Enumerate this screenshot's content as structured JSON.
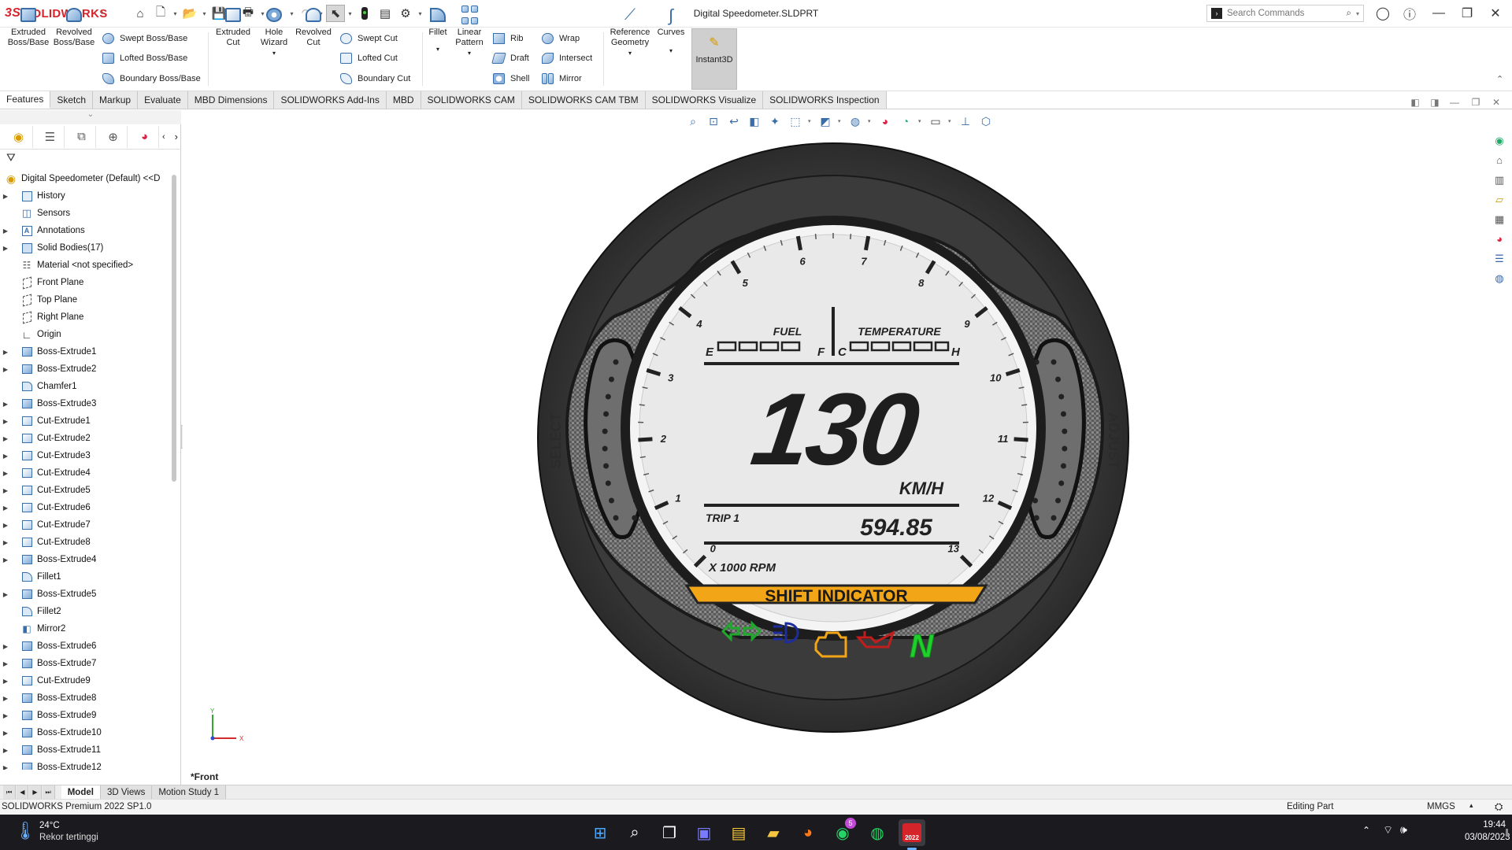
{
  "app": {
    "brand_ds": "3S",
    "brand_name": "SOLIDWORKS",
    "document_title": "Digital Speedometer.SLDPRT"
  },
  "search": {
    "placeholder": "Search Commands"
  },
  "ribbon": {
    "extruded_boss": "Extruded\nBoss/Base",
    "revolved_boss": "Revolved\nBoss/Base",
    "swept_boss": "Swept Boss/Base",
    "lofted_boss": "Lofted Boss/Base",
    "boundary_boss": "Boundary Boss/Base",
    "extruded_cut": "Extruded\nCut",
    "hole_wizard": "Hole\nWizard",
    "revolved_cut": "Revolved\nCut",
    "swept_cut": "Swept Cut",
    "lofted_cut": "Lofted Cut",
    "boundary_cut": "Boundary Cut",
    "fillet": "Fillet",
    "linear_pattern": "Linear\nPattern",
    "rib": "Rib",
    "draft": "Draft",
    "shell": "Shell",
    "wrap": "Wrap",
    "intersect": "Intersect",
    "mirror": "Mirror",
    "reference_geometry": "Reference\nGeometry",
    "curves": "Curves",
    "instant3d": "Instant3D"
  },
  "tabs": [
    "Features",
    "Sketch",
    "Markup",
    "Evaluate",
    "MBD Dimensions",
    "SOLIDWORKS Add-Ins",
    "MBD",
    "SOLIDWORKS CAM",
    "SOLIDWORKS CAM TBM",
    "SOLIDWORKS Visualize",
    "SOLIDWORKS Inspection"
  ],
  "tree": {
    "root": "Digital Speedometer (Default) <<D",
    "items": [
      {
        "label": "History",
        "icon": "history-icon",
        "exp": true
      },
      {
        "label": "Sensors",
        "icon": "sensors-icon",
        "exp": false
      },
      {
        "label": "Annotations",
        "icon": "annotations-icon",
        "exp": true
      },
      {
        "label": "Solid Bodies(17)",
        "icon": "solid-bodies-icon",
        "exp": true
      },
      {
        "label": "Material <not specified>",
        "icon": "material-icon",
        "exp": false
      },
      {
        "label": "Front Plane",
        "icon": "plane-icon",
        "exp": false
      },
      {
        "label": "Top Plane",
        "icon": "plane-icon",
        "exp": false
      },
      {
        "label": "Right Plane",
        "icon": "plane-icon",
        "exp": false
      },
      {
        "label": "Origin",
        "icon": "origin-icon",
        "exp": false
      },
      {
        "label": "Boss-Extrude1",
        "icon": "boss-extrude-icon",
        "exp": true
      },
      {
        "label": "Boss-Extrude2",
        "icon": "boss-extrude-icon",
        "exp": true
      },
      {
        "label": "Chamfer1",
        "icon": "chamfer-icon",
        "exp": false
      },
      {
        "label": "Boss-Extrude3",
        "icon": "boss-extrude-icon",
        "exp": true
      },
      {
        "label": "Cut-Extrude1",
        "icon": "cut-extrude-icon",
        "exp": true
      },
      {
        "label": "Cut-Extrude2",
        "icon": "cut-extrude-icon",
        "exp": true
      },
      {
        "label": "Cut-Extrude3",
        "icon": "cut-extrude-icon",
        "exp": true
      },
      {
        "label": "Cut-Extrude4",
        "icon": "cut-extrude-icon",
        "exp": true
      },
      {
        "label": "Cut-Extrude5",
        "icon": "cut-extrude-icon",
        "exp": true
      },
      {
        "label": "Cut-Extrude6",
        "icon": "cut-extrude-icon",
        "exp": true
      },
      {
        "label": "Cut-Extrude7",
        "icon": "cut-extrude-icon",
        "exp": true
      },
      {
        "label": "Cut-Extrude8",
        "icon": "cut-extrude-icon",
        "exp": true
      },
      {
        "label": "Boss-Extrude4",
        "icon": "boss-extrude-icon",
        "exp": true
      },
      {
        "label": "Fillet1",
        "icon": "fillet-icon",
        "exp": false
      },
      {
        "label": "Boss-Extrude5",
        "icon": "boss-extrude-icon",
        "exp": true
      },
      {
        "label": "Fillet2",
        "icon": "fillet-icon",
        "exp": false
      },
      {
        "label": "Mirror2",
        "icon": "mirror-icon",
        "exp": false
      },
      {
        "label": "Boss-Extrude6",
        "icon": "boss-extrude-icon",
        "exp": true
      },
      {
        "label": "Boss-Extrude7",
        "icon": "boss-extrude-icon",
        "exp": true
      },
      {
        "label": "Cut-Extrude9",
        "icon": "cut-extrude-icon",
        "exp": true
      },
      {
        "label": "Boss-Extrude8",
        "icon": "boss-extrude-icon",
        "exp": true
      },
      {
        "label": "Boss-Extrude9",
        "icon": "boss-extrude-icon",
        "exp": true
      },
      {
        "label": "Boss-Extrude10",
        "icon": "boss-extrude-icon",
        "exp": true
      },
      {
        "label": "Boss-Extrude11",
        "icon": "boss-extrude-icon",
        "exp": true
      },
      {
        "label": "Boss-Extrude12",
        "icon": "boss-extrude-icon",
        "exp": true
      }
    ]
  },
  "model": {
    "side_left": "SELECT",
    "side_right": "ADJUST",
    "fuel": "FUEL",
    "temperature": "TEMPERATURE",
    "e": "E",
    "f": "F",
    "c": "C",
    "h": "H",
    "speed": "130",
    "unit": "KM/H",
    "trip_label": "TRIP 1",
    "trip_value": "594.85",
    "rpm_label": "X 1000 RPM",
    "shift": "SHIFT INDICATOR",
    "neutral": "N",
    "rpm_ticks": [
      "0",
      "1",
      "2",
      "3",
      "4",
      "5",
      "6",
      "7",
      "8",
      "9",
      "10",
      "11",
      "12",
      "13"
    ]
  },
  "view": {
    "label": "*Front",
    "triad_y": "Y",
    "triad_x": "X"
  },
  "bottom_tabs": [
    "Model",
    "3D Views",
    "Motion Study 1"
  ],
  "status": {
    "version": "SOLIDWORKS Premium 2022 SP1.0",
    "mode": "Editing Part",
    "units": "MMGS"
  },
  "taskbar": {
    "weather_temp": "24°C",
    "weather_text": "Rekor tertinggi",
    "time": "19:44",
    "date": "03/08/2023",
    "whatsapp_badge": "5",
    "sw_label": "2022"
  },
  "colors": {
    "accent_red": "#d6242b",
    "shift_bar": "#f2a516",
    "neutral_green": "#1fcf2c"
  }
}
